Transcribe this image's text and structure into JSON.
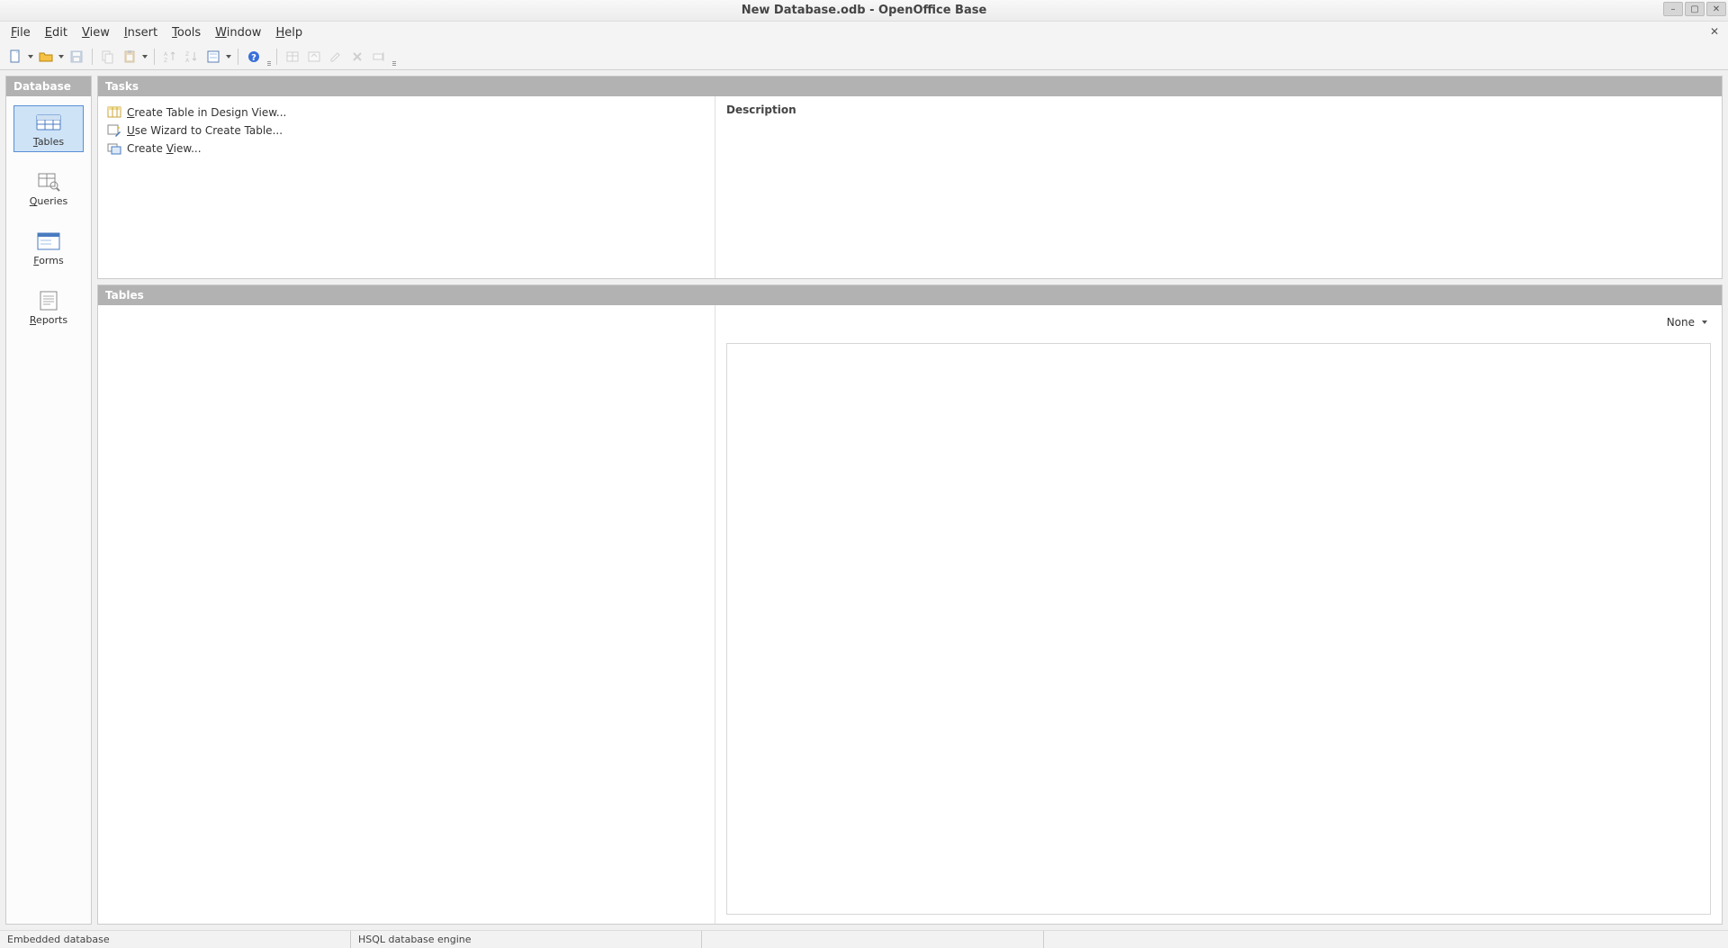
{
  "window": {
    "title": "New Database.odb - OpenOffice Base"
  },
  "menubar": {
    "items": [
      "File",
      "Edit",
      "View",
      "Insert",
      "Tools",
      "Window",
      "Help"
    ]
  },
  "sidebar": {
    "header": "Database",
    "items": [
      {
        "label": "Tables",
        "accel_index": 0,
        "selected": true
      },
      {
        "label": "Queries",
        "accel_index": 0,
        "selected": false
      },
      {
        "label": "Forms",
        "accel_index": 0,
        "selected": false
      },
      {
        "label": "Reports",
        "accel_index": 0,
        "selected": false
      }
    ]
  },
  "tasks": {
    "header": "Tasks",
    "items": [
      {
        "label": "Create Table in Design View...",
        "accel_index": 0
      },
      {
        "label": "Use Wizard to Create Table...",
        "accel_index": 0
      },
      {
        "label": "Create View...",
        "accel_index": 7
      }
    ],
    "description_header": "Description"
  },
  "tables_panel": {
    "header": "Tables",
    "preview_mode": "None"
  },
  "statusbar": {
    "db_type": "Embedded database",
    "engine": "HSQL database engine"
  }
}
